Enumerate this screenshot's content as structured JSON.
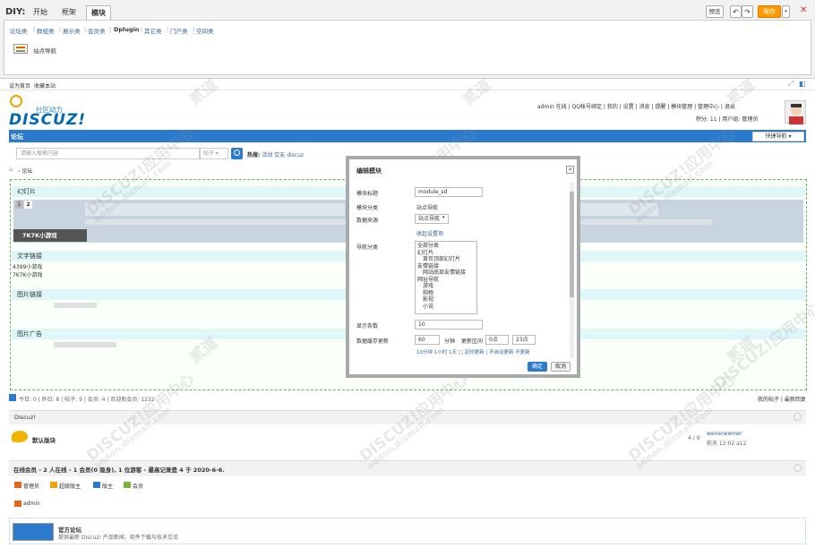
{
  "diy": {
    "label": "DIY:",
    "tabs": [
      "开始",
      "框架",
      "模块"
    ],
    "categories": [
      "论坛类",
      "群组类",
      "展示类",
      "会员类",
      "Dplugin",
      "其它类",
      "门户类",
      "空间类"
    ],
    "block_item": "站点导航",
    "preview": "预览",
    "save": "保存",
    "close": "✕"
  },
  "toplinks": {
    "set_home": "设为首页",
    "bookmark": "收藏本站"
  },
  "header": {
    "logo": "DISCUZ!",
    "logo_sub": "社区动力",
    "userbar": "admin 在线 | QQ帐号绑定 | 我的 | 设置 | 消息 | 提醒 | 模块管理 | 管理中心 | 退出",
    "userbar2": "积分: 11 | 用户组: 管理员"
  },
  "nav": {
    "forum": "论坛",
    "quick_nav": "快捷导航 ▾"
  },
  "search": {
    "placeholder": "请输入搜索内容",
    "type": "帖子 ▾",
    "hot_label": "热搜:",
    "hot": [
      "活动",
      "交友",
      "discuz"
    ]
  },
  "breadcrumb": "› 论坛",
  "blocks": {
    "slideshow": "幻灯片",
    "slide_pages": [
      "1",
      "2"
    ],
    "slide_caption": "7K7K小游戏",
    "text_links": "文字链接",
    "text_link_items": [
      "4399小游戏",
      "7K7K小游戏"
    ],
    "image_links": "图片链接",
    "image_ads": "图片广告"
  },
  "stats": {
    "left": "今日: 0 | 昨日: 8 | 帖子: 9 | 会员: 4 | 欢迎新会员: 1232",
    "right": "我的帖子 | 最新回复"
  },
  "forum": {
    "category": "Discuz!",
    "board": "默认版块",
    "count": "4 / 9",
    "last_user": "wenenewnwr",
    "last_time": "前天 12:02 a12"
  },
  "online": {
    "title": "在线会员 - 2 人在线 - 1 会员(0 隐身), 1 位游客 - 最高记录是 4 于 2020-6-6.",
    "groups": [
      "管理员",
      "超级版主",
      "版主",
      "会员"
    ],
    "member": "admin"
  },
  "links": {
    "name": "官方论坛",
    "desc": "提供最新 Discuz! 产品新闻、软件下载与技术交流"
  },
  "modal": {
    "title": "编辑模块",
    "close": "✕",
    "fields": {
      "title_label": "模块标题",
      "title_value": "module_sd",
      "category_label": "模块分类",
      "category_value": "站点导航",
      "source_label": "数据来源",
      "source_value": "站点导航",
      "more_settings": "收起设置项",
      "nav_label": "导航分类",
      "nav_items": [
        "全部分类",
        "幻灯片",
        "　首页顶部幻灯片",
        "友情链接",
        "　网站底部友情链接",
        "网址导航",
        "　游戏",
        "　购物",
        "　影视",
        "　小说"
      ],
      "count_label": "显示条数",
      "count_value": "10",
      "cache_label": "数据缓存更新",
      "cache_value": "60",
      "cache_unit": "分钟",
      "interval_label": "更新区间",
      "interval_from": "0点",
      "interval_to": "23点",
      "quick_values": "10分钟  1小时  1天  □ 定时更新  |  不自动更新  不更新"
    },
    "ok": "确定",
    "cancel": "取消"
  },
  "watermark": {
    "brand": "DISCUZ!应用中心",
    "domain": "addon.dismall.com",
    "mark": "贰道"
  },
  "colors": {
    "nav": "#2b7acd",
    "accent": "#f90",
    "frame": "#5cb85c",
    "block_head": "#dff7f9"
  }
}
